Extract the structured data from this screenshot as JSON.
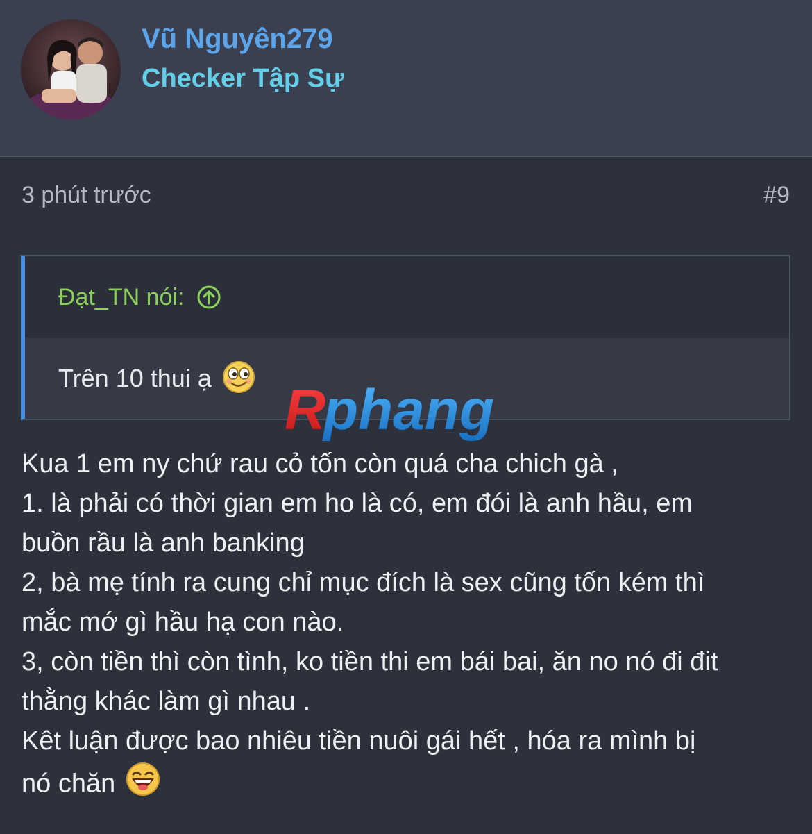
{
  "user": {
    "name": "Vũ Nguyên279",
    "title": "Checker Tập Sự"
  },
  "post": {
    "time": "3 phút trước",
    "number": "#9",
    "quote": {
      "author": "Đạt_TN nói:",
      "text": "Trên 10 thui ạ"
    },
    "lines": [
      "Kua 1 em ny chứ rau cỏ tốn còn quá cha chich gà ,",
      "1. là phải có thời gian em ho là có, em đói là anh hầu, em",
      "buồn rầu là anh banking",
      "2, bà mẹ tính ra cung chỉ mục đích là sex cũng tốn kém thì",
      "mắc mớ gì hầu hạ con nào.",
      "3, còn tiền thì còn tình, ko tiền thi em bái bai, ăn no nó đi đit",
      "thằng khác làm gì nhau .",
      "Kêt luận được bao nhiêu tiền nuôi gái hết , hóa ra mình bị",
      "nó chăn"
    ]
  },
  "watermark": "Rphang",
  "icons": {
    "quote_jump": "arrow-up-circle-icon",
    "smiley_1": "winking-smiley-icon",
    "smiley_2": "laughing-smiley-icon"
  },
  "colors": {
    "username": "#5da5ea",
    "usertitle": "#63cfe8",
    "quote_author": "#8cd15b",
    "quote_border": "#4a8fe0"
  }
}
